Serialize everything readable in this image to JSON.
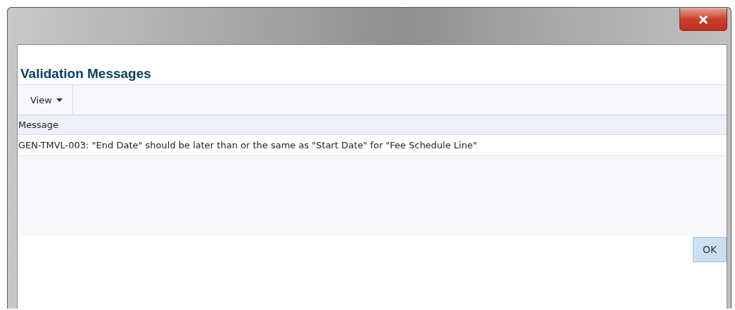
{
  "dialog": {
    "heading": "Validation Messages"
  },
  "toolbar": {
    "menus": [
      "View"
    ]
  },
  "table": {
    "columns": [
      "Message"
    ],
    "rows": [
      [
        "GEN-TMVL-003: \"End Date\" should be later than or the same as \"Start Date\" for \"Fee Schedule Line\""
      ]
    ]
  },
  "buttons": [
    "OK"
  ]
}
